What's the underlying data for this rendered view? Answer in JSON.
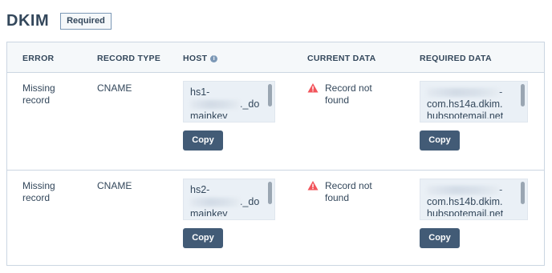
{
  "header": {
    "title": "DKIM",
    "badge": "Required"
  },
  "table": {
    "columns": {
      "error": "ERROR",
      "record_type": "RECORD TYPE",
      "host": "HOST",
      "current_data": "CURRENT DATA",
      "required_data": "REQUIRED DATA"
    },
    "rows": [
      {
        "error": "Missing record",
        "record_type": "CNAME",
        "host_line1": "hs1-",
        "host_line2": "._do",
        "host_line3": "mainkey",
        "current": "Record not found",
        "required_line1": "-",
        "required_line2": "com.hs14a.dkim.",
        "required_line3": "hubspotemail.net",
        "copy_label": "Copy"
      },
      {
        "error": "Missing record",
        "record_type": "CNAME",
        "host_line1": "hs2-",
        "host_line2": "._do",
        "host_line3": "mainkey",
        "current": "Record not found",
        "required_line1": "-",
        "required_line2": "com.hs14b.dkim.",
        "required_line3": "hubspotemail.net",
        "copy_label": "Copy"
      }
    ]
  },
  "icons": {
    "info": "info-icon",
    "warning": "warning-triangle-icon"
  },
  "colors": {
    "button": "#425b76",
    "warning": "#f2545b",
    "header_bg": "#f5f8fa",
    "border": "#cbd6e2"
  }
}
